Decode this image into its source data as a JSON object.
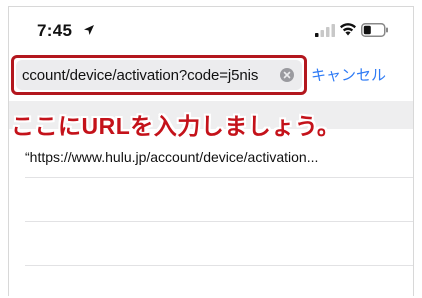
{
  "status_bar": {
    "time": "7:45",
    "icons": [
      "location-arrow-icon",
      "cellular-signal-icon",
      "wifi-icon",
      "battery-icon"
    ]
  },
  "address_bar": {
    "url_value": "ccount/device/activation?code=j5nis",
    "cancel_label": "キャンセル",
    "accent_color": "#2f7bf5"
  },
  "annotation": {
    "text": "ここにURLを入力しましょう。",
    "color": "#c4121a",
    "highlight_color": "#b3171e"
  },
  "suggestions": [
    {
      "text": "“https://www.hulu.jp/account/device/activation..."
    }
  ]
}
